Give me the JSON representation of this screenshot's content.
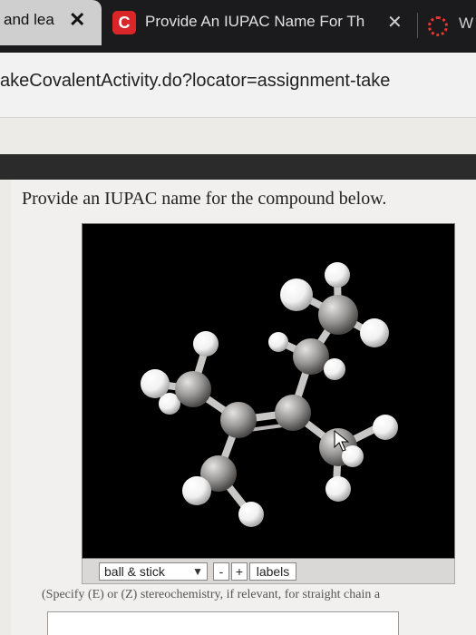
{
  "browser": {
    "tab_left": {
      "label": "and lea",
      "close": "✕"
    },
    "tab_active": {
      "favicon": "C",
      "label": "Provide An IUPAC Name For Th",
      "close": "✕"
    },
    "tab_next": {
      "label": "W"
    },
    "url": "akeCovalentActivity.do?locator=assignment-take"
  },
  "question": {
    "text": "Provide an IUPAC name for the compound below.",
    "hint": "(Specify (E) or (Z) stereochemistry, if relevant, for straight chain a",
    "answer_value": ""
  },
  "viewer": {
    "mode": "ball & stick",
    "minus": "-",
    "plus": "+",
    "labels": "labels"
  },
  "colors": {
    "favicon_bg": "#d8262a",
    "carbon": "#9a9896",
    "hydrogen": "#f4f4f4"
  }
}
